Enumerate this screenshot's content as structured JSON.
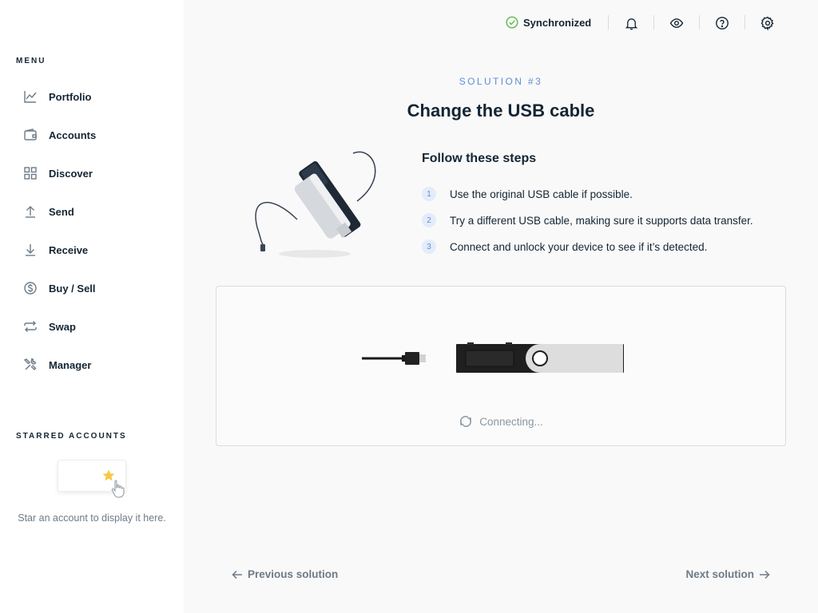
{
  "sidebar": {
    "menu_title": "MENU",
    "items": [
      {
        "label": "Portfolio",
        "icon": "chart-line-icon"
      },
      {
        "label": "Accounts",
        "icon": "wallet-icon"
      },
      {
        "label": "Discover",
        "icon": "grid-icon"
      },
      {
        "label": "Send",
        "icon": "arrow-up-icon"
      },
      {
        "label": "Receive",
        "icon": "arrow-down-icon"
      },
      {
        "label": "Buy / Sell",
        "icon": "dollar-circle-icon"
      },
      {
        "label": "Swap",
        "icon": "swap-icon"
      },
      {
        "label": "Manager",
        "icon": "tools-icon"
      }
    ],
    "starred_title": "STARRED ACCOUNTS",
    "starred_empty_text": "Star an account to display it here."
  },
  "topbar": {
    "sync_status": "Synchronized",
    "icons": [
      "bell-icon",
      "eye-icon",
      "help-icon",
      "settings-icon"
    ]
  },
  "main": {
    "subtitle": "SOLUTION #3",
    "title": "Change the USB cable",
    "steps_title": "Follow these steps",
    "steps": [
      {
        "num": "1",
        "text": "Use the original USB cable if possible."
      },
      {
        "num": "2",
        "text": "Try a different USB cable, making sure it supports data transfer."
      },
      {
        "num": "3",
        "text": "Connect and unlock your device to see if it’s detected."
      }
    ],
    "connecting_text": "Connecting...",
    "prev_label": "Previous solution",
    "next_label": "Next solution"
  },
  "colors": {
    "accent": "#5c8fd6",
    "success": "#66be54",
    "text": "#142533",
    "muted": "#6d7b87"
  }
}
